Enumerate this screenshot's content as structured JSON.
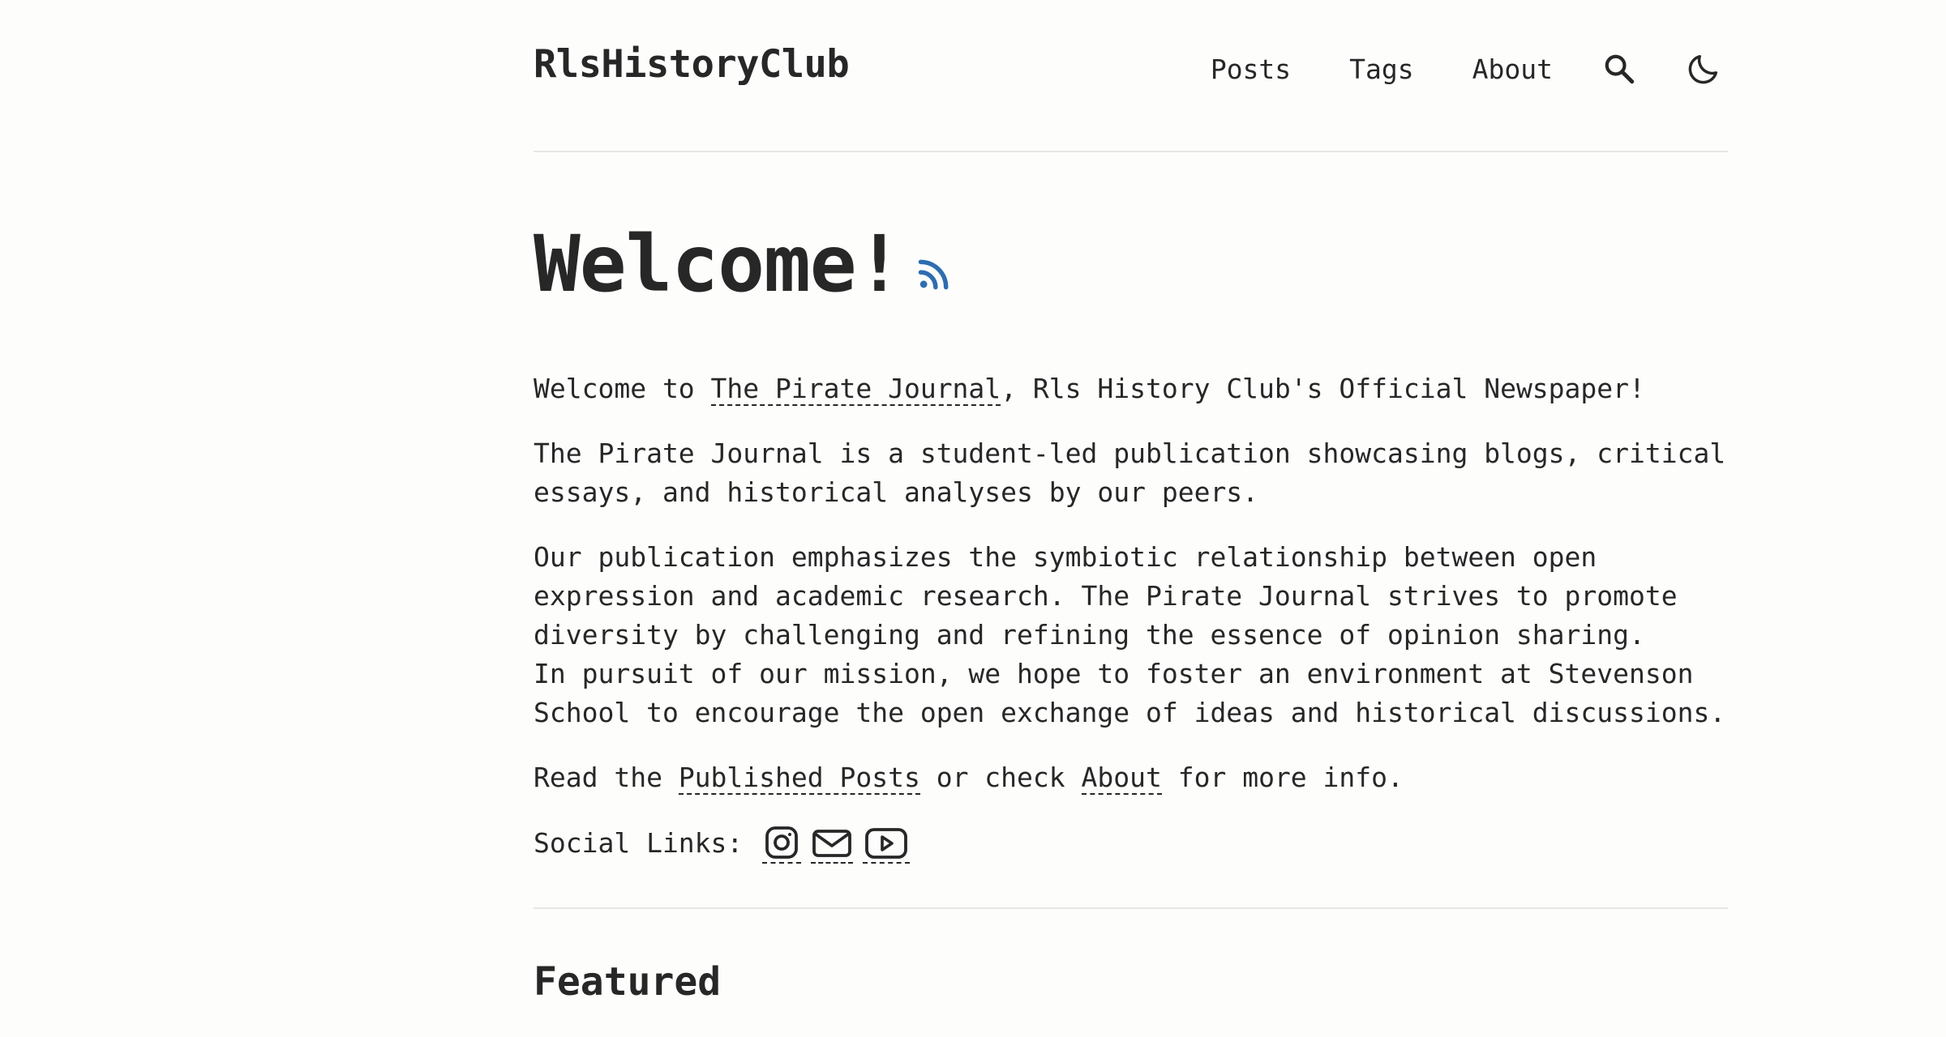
{
  "header": {
    "site_title": "RlsHistoryClub",
    "nav": [
      {
        "label": "Posts"
      },
      {
        "label": "Tags"
      },
      {
        "label": "About"
      }
    ],
    "search_icon": "search-icon",
    "theme_icon": "moon-icon"
  },
  "hero": {
    "title": "Welcome!",
    "rss_icon": "rss-icon",
    "rss_color": "#2e6db0"
  },
  "intro": {
    "p1_prefix": "Welcome to ",
    "p1_link": "The Pirate Journal",
    "p1_suffix": ", Rls History Club's Official Newspaper!",
    "p2": "The Pirate Journal is a student-led publication showcasing blogs, critical essays, and historical analyses by our peers.",
    "p3_line1": "Our publication emphasizes the symbiotic relationship between open expression and academic research. The Pirate Journal strives to promote diversity by challenging and refining the essence of opinion sharing.",
    "p3_line2": "In pursuit of our mission, we hope to foster an environment at Stevenson School to encourage the open exchange of ideas and historical discussions.",
    "p4_prefix": "Read the ",
    "p4_link1": "Published Posts",
    "p4_middle": " or check ",
    "p4_link2": "About",
    "p4_suffix": " for more info."
  },
  "social": {
    "label": "Social Links:",
    "icons": [
      "instagram-icon",
      "mail-icon",
      "youtube-icon"
    ]
  },
  "featured": {
    "title": "Featured"
  }
}
